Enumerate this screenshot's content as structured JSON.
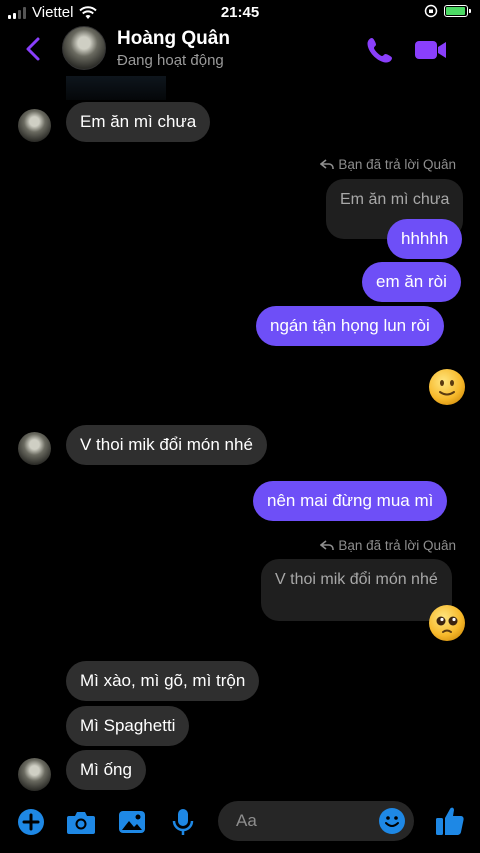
{
  "status_bar": {
    "carrier": "Viettel",
    "time": "21:45"
  },
  "header": {
    "name": "Hoàng Quân",
    "status": "Đang hoạt động"
  },
  "messages": [
    {
      "text": "Em ăn mì chưa"
    },
    {
      "reply_note": "Bạn đã trả lời Quân",
      "quote": "Em ăn mì chưa"
    },
    {
      "text": "hhhhh"
    },
    {
      "text": "em ăn ròi"
    },
    {
      "text": "ngán tận họng lun ròi"
    },
    {
      "emoji": "slightly-smiling-face"
    },
    {
      "text": "V thoi mik đổi món nhé"
    },
    {
      "text": "nên mai đừng mua mì"
    },
    {
      "reply_note": "Bạn đã trả lời Quân",
      "quote": "V thoi mik đổi món nhé"
    },
    {
      "emoji": "pleading-face"
    },
    {
      "text": "Mì xào, mì gõ, mì trộn"
    },
    {
      "text": "Mì Spaghetti"
    },
    {
      "text": "Mì ống"
    }
  ],
  "composer": {
    "placeholder": "Aa"
  },
  "colors": {
    "accent": "#8a3ffc",
    "outgoing_bubble": "#6e4ff7",
    "incoming_bubble": "#2f2f2f",
    "composer_icons": "#1e88e5"
  }
}
